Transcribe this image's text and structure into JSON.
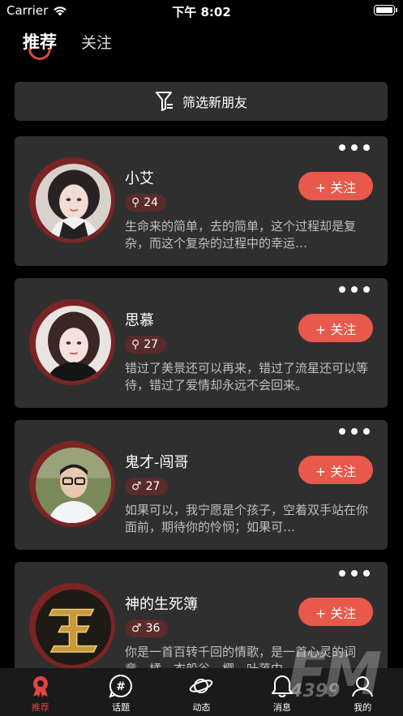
{
  "status_bar": {
    "carrier": "Carrier",
    "time": "下午 8:02"
  },
  "tabs": [
    {
      "label": "推荐",
      "active": true
    },
    {
      "label": "关注",
      "active": false
    }
  ],
  "filter": {
    "label": "筛选新朋友"
  },
  "cards": [
    {
      "name": "小艾",
      "sex": "female",
      "age": "24",
      "follow_label": "+ 关注",
      "bio": "生命来的简单，去的简单，这个过程却是复杂，而这个复杂的过程中的幸运…"
    },
    {
      "name": "思慕",
      "sex": "female",
      "age": "27",
      "follow_label": "+ 关注",
      "bio": "错过了美景还可以再来，错过了流星还可以等待，错过了爱情却永远不会回来。"
    },
    {
      "name": "鬼才-闯哥",
      "sex": "male",
      "age": "27",
      "follow_label": "+ 关注",
      "bio": "如果可以，我宁愿是个孩子，空着双手站在你面前，期待你的怜悯；如果可…"
    },
    {
      "name": "神的生死簿",
      "sex": "male",
      "age": "36",
      "follow_label": "+ 关注",
      "bio": "你是一首百转千回的情歌，是一首心灵的词章，橘、衣般谷、樱、叶落中"
    }
  ],
  "symbols": {
    "female": "⚲",
    "male": "♂"
  },
  "nav": [
    {
      "label": "推荐",
      "icon": "recommend-icon",
      "active": true
    },
    {
      "label": "话题",
      "icon": "hashtag-icon",
      "active": false
    },
    {
      "label": "动态",
      "icon": "planet-icon",
      "active": false
    },
    {
      "label": "消息",
      "icon": "bell-icon",
      "active": false
    },
    {
      "label": "我的",
      "icon": "user-icon",
      "active": false
    }
  ],
  "watermark": {
    "text": "FM",
    "sub": "4399"
  },
  "colors": {
    "accent": "#e1453f",
    "follow": "#e8584b",
    "card": "#2f2f2f",
    "background": "#000000"
  }
}
